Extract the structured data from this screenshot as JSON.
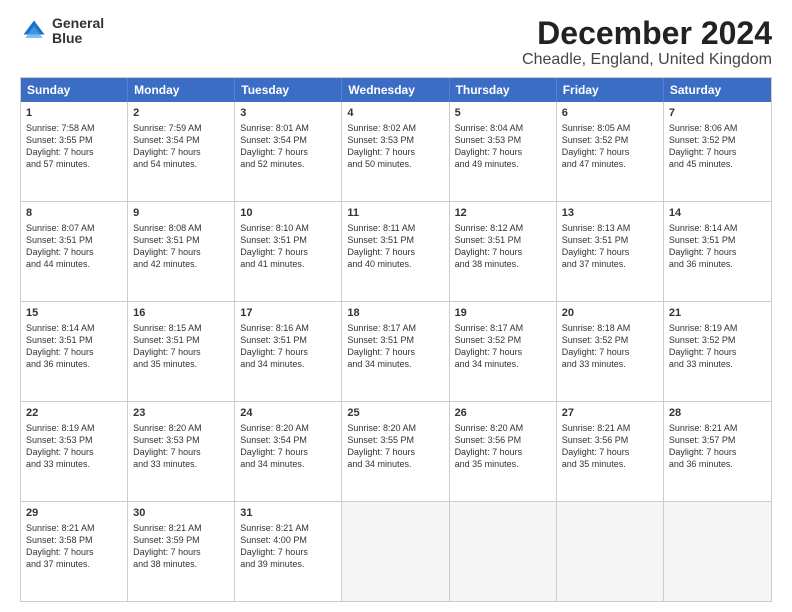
{
  "header": {
    "logo_line1": "General",
    "logo_line2": "Blue",
    "title": "December 2024",
    "subtitle": "Cheadle, England, United Kingdom"
  },
  "calendar": {
    "days": [
      "Sunday",
      "Monday",
      "Tuesday",
      "Wednesday",
      "Thursday",
      "Friday",
      "Saturday"
    ],
    "rows": [
      [
        {
          "day": "1",
          "lines": [
            "Sunrise: 7:58 AM",
            "Sunset: 3:55 PM",
            "Daylight: 7 hours",
            "and 57 minutes."
          ]
        },
        {
          "day": "2",
          "lines": [
            "Sunrise: 7:59 AM",
            "Sunset: 3:54 PM",
            "Daylight: 7 hours",
            "and 54 minutes."
          ]
        },
        {
          "day": "3",
          "lines": [
            "Sunrise: 8:01 AM",
            "Sunset: 3:54 PM",
            "Daylight: 7 hours",
            "and 52 minutes."
          ]
        },
        {
          "day": "4",
          "lines": [
            "Sunrise: 8:02 AM",
            "Sunset: 3:53 PM",
            "Daylight: 7 hours",
            "and 50 minutes."
          ]
        },
        {
          "day": "5",
          "lines": [
            "Sunrise: 8:04 AM",
            "Sunset: 3:53 PM",
            "Daylight: 7 hours",
            "and 49 minutes."
          ]
        },
        {
          "day": "6",
          "lines": [
            "Sunrise: 8:05 AM",
            "Sunset: 3:52 PM",
            "Daylight: 7 hours",
            "and 47 minutes."
          ]
        },
        {
          "day": "7",
          "lines": [
            "Sunrise: 8:06 AM",
            "Sunset: 3:52 PM",
            "Daylight: 7 hours",
            "and 45 minutes."
          ]
        }
      ],
      [
        {
          "day": "8",
          "lines": [
            "Sunrise: 8:07 AM",
            "Sunset: 3:51 PM",
            "Daylight: 7 hours",
            "and 44 minutes."
          ]
        },
        {
          "day": "9",
          "lines": [
            "Sunrise: 8:08 AM",
            "Sunset: 3:51 PM",
            "Daylight: 7 hours",
            "and 42 minutes."
          ]
        },
        {
          "day": "10",
          "lines": [
            "Sunrise: 8:10 AM",
            "Sunset: 3:51 PM",
            "Daylight: 7 hours",
            "and 41 minutes."
          ]
        },
        {
          "day": "11",
          "lines": [
            "Sunrise: 8:11 AM",
            "Sunset: 3:51 PM",
            "Daylight: 7 hours",
            "and 40 minutes."
          ]
        },
        {
          "day": "12",
          "lines": [
            "Sunrise: 8:12 AM",
            "Sunset: 3:51 PM",
            "Daylight: 7 hours",
            "and 38 minutes."
          ]
        },
        {
          "day": "13",
          "lines": [
            "Sunrise: 8:13 AM",
            "Sunset: 3:51 PM",
            "Daylight: 7 hours",
            "and 37 minutes."
          ]
        },
        {
          "day": "14",
          "lines": [
            "Sunrise: 8:14 AM",
            "Sunset: 3:51 PM",
            "Daylight: 7 hours",
            "and 36 minutes."
          ]
        }
      ],
      [
        {
          "day": "15",
          "lines": [
            "Sunrise: 8:14 AM",
            "Sunset: 3:51 PM",
            "Daylight: 7 hours",
            "and 36 minutes."
          ]
        },
        {
          "day": "16",
          "lines": [
            "Sunrise: 8:15 AM",
            "Sunset: 3:51 PM",
            "Daylight: 7 hours",
            "and 35 minutes."
          ]
        },
        {
          "day": "17",
          "lines": [
            "Sunrise: 8:16 AM",
            "Sunset: 3:51 PM",
            "Daylight: 7 hours",
            "and 34 minutes."
          ]
        },
        {
          "day": "18",
          "lines": [
            "Sunrise: 8:17 AM",
            "Sunset: 3:51 PM",
            "Daylight: 7 hours",
            "and 34 minutes."
          ]
        },
        {
          "day": "19",
          "lines": [
            "Sunrise: 8:17 AM",
            "Sunset: 3:52 PM",
            "Daylight: 7 hours",
            "and 34 minutes."
          ]
        },
        {
          "day": "20",
          "lines": [
            "Sunrise: 8:18 AM",
            "Sunset: 3:52 PM",
            "Daylight: 7 hours",
            "and 33 minutes."
          ]
        },
        {
          "day": "21",
          "lines": [
            "Sunrise: 8:19 AM",
            "Sunset: 3:52 PM",
            "Daylight: 7 hours",
            "and 33 minutes."
          ]
        }
      ],
      [
        {
          "day": "22",
          "lines": [
            "Sunrise: 8:19 AM",
            "Sunset: 3:53 PM",
            "Daylight: 7 hours",
            "and 33 minutes."
          ]
        },
        {
          "day": "23",
          "lines": [
            "Sunrise: 8:20 AM",
            "Sunset: 3:53 PM",
            "Daylight: 7 hours",
            "and 33 minutes."
          ]
        },
        {
          "day": "24",
          "lines": [
            "Sunrise: 8:20 AM",
            "Sunset: 3:54 PM",
            "Daylight: 7 hours",
            "and 34 minutes."
          ]
        },
        {
          "day": "25",
          "lines": [
            "Sunrise: 8:20 AM",
            "Sunset: 3:55 PM",
            "Daylight: 7 hours",
            "and 34 minutes."
          ]
        },
        {
          "day": "26",
          "lines": [
            "Sunrise: 8:20 AM",
            "Sunset: 3:56 PM",
            "Daylight: 7 hours",
            "and 35 minutes."
          ]
        },
        {
          "day": "27",
          "lines": [
            "Sunrise: 8:21 AM",
            "Sunset: 3:56 PM",
            "Daylight: 7 hours",
            "and 35 minutes."
          ]
        },
        {
          "day": "28",
          "lines": [
            "Sunrise: 8:21 AM",
            "Sunset: 3:57 PM",
            "Daylight: 7 hours",
            "and 36 minutes."
          ]
        }
      ],
      [
        {
          "day": "29",
          "lines": [
            "Sunrise: 8:21 AM",
            "Sunset: 3:58 PM",
            "Daylight: 7 hours",
            "and 37 minutes."
          ]
        },
        {
          "day": "30",
          "lines": [
            "Sunrise: 8:21 AM",
            "Sunset: 3:59 PM",
            "Daylight: 7 hours",
            "and 38 minutes."
          ]
        },
        {
          "day": "31",
          "lines": [
            "Sunrise: 8:21 AM",
            "Sunset: 4:00 PM",
            "Daylight: 7 hours",
            "and 39 minutes."
          ]
        },
        {
          "day": "",
          "lines": []
        },
        {
          "day": "",
          "lines": []
        },
        {
          "day": "",
          "lines": []
        },
        {
          "day": "",
          "lines": []
        }
      ]
    ]
  }
}
